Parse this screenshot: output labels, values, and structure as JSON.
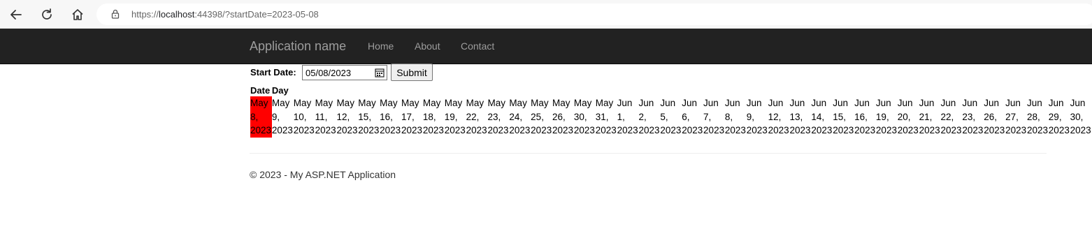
{
  "browser": {
    "url_scheme": "https://",
    "url_host": "localhost",
    "url_rest": ":44398/?startDate=2023-05-08",
    "icons": [
      "back-arrow-icon",
      "reload-icon",
      "home-icon",
      "lock-icon"
    ]
  },
  "navbar": {
    "brand": "Application name",
    "links": [
      "Home",
      "About",
      "Contact"
    ],
    "background": "#222222",
    "link_color": "#9d9d9d"
  },
  "form": {
    "start_label": "Start Date:",
    "date_value": "05/08/2023",
    "submit_label": "Submit"
  },
  "table": {
    "headers": [
      "Date",
      "Day"
    ],
    "selected_color": "#ff0000",
    "dates": [
      [
        "May",
        "8,",
        "2023"
      ],
      [
        "May",
        "9,",
        "2023"
      ],
      [
        "May",
        "10,",
        "2023"
      ],
      [
        "May",
        "11,",
        "2023"
      ],
      [
        "May",
        "12,",
        "2023"
      ],
      [
        "May",
        "15,",
        "2023"
      ],
      [
        "May",
        "16,",
        "2023"
      ],
      [
        "May",
        "17,",
        "2023"
      ],
      [
        "May",
        "18,",
        "2023"
      ],
      [
        "May",
        "19,",
        "2023"
      ],
      [
        "May",
        "22,",
        "2023"
      ],
      [
        "May",
        "23,",
        "2023"
      ],
      [
        "May",
        "24,",
        "2023"
      ],
      [
        "May",
        "25,",
        "2023"
      ],
      [
        "May",
        "26,",
        "2023"
      ],
      [
        "May",
        "30,",
        "2023"
      ],
      [
        "May",
        "31,",
        "2023"
      ],
      [
        "Jun",
        "1,",
        "2023"
      ],
      [
        "Jun",
        "2,",
        "2023"
      ],
      [
        "Jun",
        "5,",
        "2023"
      ],
      [
        "Jun",
        "6,",
        "2023"
      ],
      [
        "Jun",
        "7,",
        "2023"
      ],
      [
        "Jun",
        "8,",
        "2023"
      ],
      [
        "Jun",
        "9,",
        "2023"
      ],
      [
        "Jun",
        "12,",
        "2023"
      ],
      [
        "Jun",
        "13,",
        "2023"
      ],
      [
        "Jun",
        "14,",
        "2023"
      ],
      [
        "Jun",
        "15,",
        "2023"
      ],
      [
        "Jun",
        "16,",
        "2023"
      ],
      [
        "Jun",
        "19,",
        "2023"
      ],
      [
        "Jun",
        "20,",
        "2023"
      ],
      [
        "Jun",
        "21,",
        "2023"
      ],
      [
        "Jun",
        "22,",
        "2023"
      ],
      [
        "Jun",
        "23,",
        "2023"
      ],
      [
        "Jun",
        "26,",
        "2023"
      ],
      [
        "Jun",
        "27,",
        "2023"
      ],
      [
        "Jun",
        "28,",
        "2023"
      ],
      [
        "Jun",
        "29,",
        "2023"
      ],
      [
        "Jun",
        "30,",
        "2023"
      ]
    ]
  },
  "footer": {
    "text": "© 2023 - My ASP.NET Application"
  }
}
